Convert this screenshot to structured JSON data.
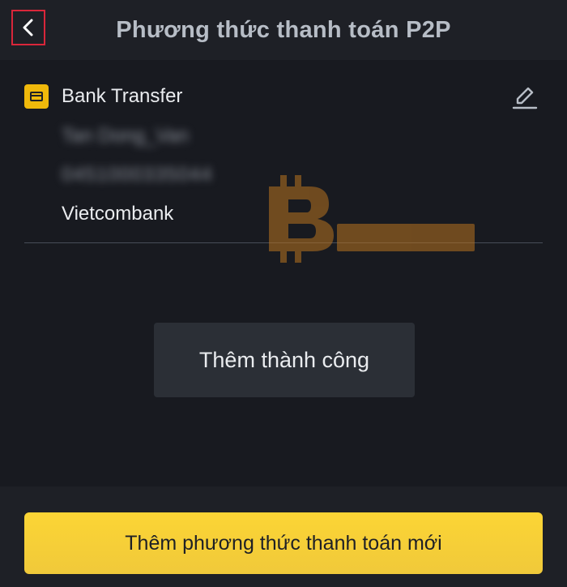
{
  "header": {
    "title": "Phương thức thanh toán P2P",
    "back_icon": "chevron-left-icon"
  },
  "payment_method": {
    "type_label": "Bank Transfer",
    "type_icon": "card-icon",
    "account_name": "Tan Dong_Van",
    "account_number": "0451000335044",
    "bank_name": "Vietcombank",
    "edit_icon": "pencil-icon"
  },
  "toast": {
    "message": "Thêm thành công"
  },
  "footer": {
    "add_button_label": "Thêm phương thức thanh toán mới"
  },
  "colors": {
    "accent": "#fcd535",
    "background": "#181a20",
    "header_bg": "#1e2026",
    "back_highlight": "#d9263a"
  }
}
